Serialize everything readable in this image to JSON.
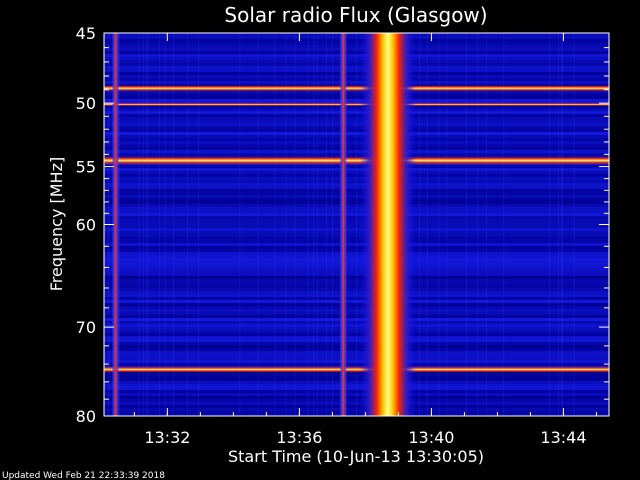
{
  "footer": {
    "updated": "Updated Wed Feb 21 22:33:39 2018"
  },
  "colors": {
    "background": "#000000",
    "axis": "#ffffff",
    "low": "#0000ff",
    "mid": "#ff2000",
    "high": "#ffff80"
  },
  "chart_data": {
    "type": "heatmap",
    "title": "Solar radio Flux (Glasgow)",
    "xlabel": "Start Time (10-Jun-13 13:30:05)",
    "ylabel": "Frequency [MHz]",
    "x_unit": "minutes after 13:30:05",
    "xlim": [
      0,
      15.3
    ],
    "ylim": [
      45,
      80
    ],
    "y_scale": "log",
    "y_inverted": true,
    "x_ticks": [
      {
        "label": "13:32",
        "value": 1.92
      },
      {
        "label": "13:36",
        "value": 5.92
      },
      {
        "label": "13:40",
        "value": 9.92
      },
      {
        "label": "13:44",
        "value": 13.92
      }
    ],
    "y_ticks": [
      {
        "label": "45",
        "value": 45
      },
      {
        "label": "50",
        "value": 50
      },
      {
        "label": "55",
        "value": 55
      },
      {
        "label": "60",
        "value": 60
      },
      {
        "label": "70",
        "value": 70
      },
      {
        "label": "80",
        "value": 80
      }
    ],
    "colormap": "blue-red-yellow (low to high flux)",
    "horizontal_interference_lines_mhz": [
      {
        "freq": 48.9,
        "intensity": "high"
      },
      {
        "freq": 50.1,
        "intensity": "medium"
      },
      {
        "freq": 54.5,
        "intensity": "very high"
      },
      {
        "freq": 74.6,
        "intensity": "high"
      }
    ],
    "vertical_features_minutes": [
      {
        "t": 0.35,
        "intensity": "medium",
        "note": "narrow red vertical line"
      },
      {
        "t": 7.25,
        "intensity": "medium",
        "note": "narrow red vertical line"
      },
      {
        "t": 8.6,
        "intensity": "very high",
        "note": "broadband radio burst, strongest around 8.5-8.8 min"
      }
    ]
  }
}
